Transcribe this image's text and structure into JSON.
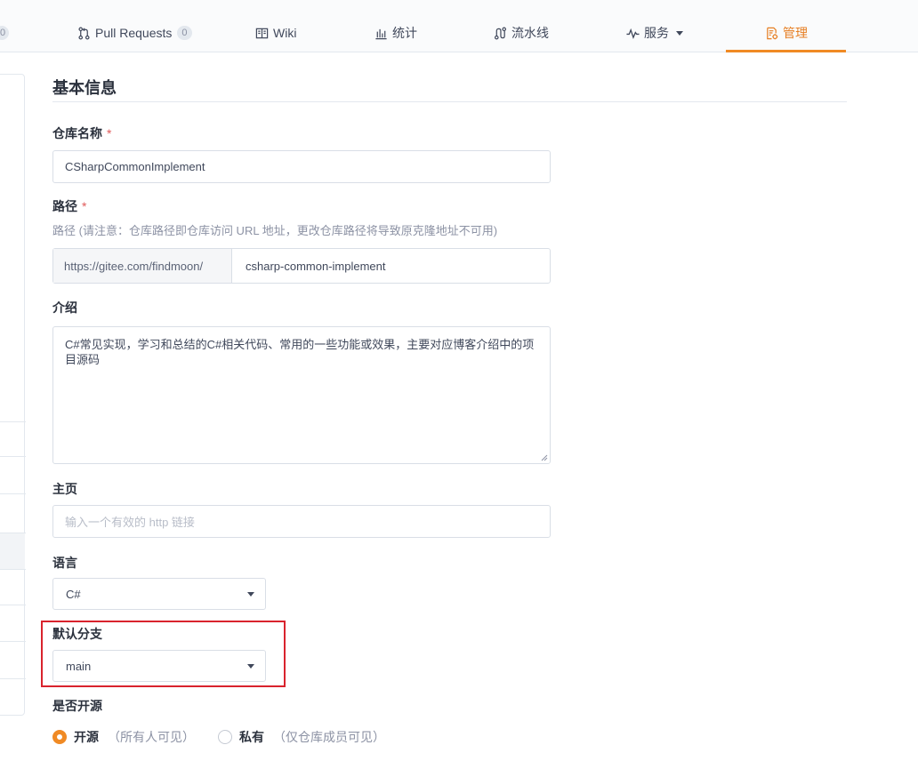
{
  "nav": {
    "left_badge": "0",
    "items": [
      {
        "label": "Pull Requests",
        "badge": "0"
      },
      {
        "label": "Wiki"
      },
      {
        "label": "统计"
      },
      {
        "label": "流水线"
      },
      {
        "label": "服务"
      },
      {
        "label": "管理"
      }
    ],
    "active_color": "#f08a24"
  },
  "form": {
    "section_title": "基本信息",
    "repo_name": {
      "label": "仓库名称",
      "required": "*",
      "value": "CSharpCommonImplement"
    },
    "path": {
      "label": "路径",
      "required": "*",
      "hint": "路径 (请注意：仓库路径即仓库访问 URL 地址，更改仓库路径将导致原克隆地址不可用)",
      "prefix": "https://gitee.com/findmoon/",
      "value": "csharp-common-implement"
    },
    "intro": {
      "label": "介绍",
      "value": "C#常见实现，学习和总结的C#相关代码、常用的一些功能或效果，主要对应博客介绍中的项目源码"
    },
    "homepage": {
      "label": "主页",
      "placeholder": "输入一个有效的 http 链接"
    },
    "language": {
      "label": "语言",
      "value": "C#"
    },
    "default_branch": {
      "label": "默认分支",
      "value": "main"
    },
    "open_source": {
      "label": "是否开源",
      "options": [
        {
          "label": "开源",
          "desc": "（所有人可见）",
          "selected": true
        },
        {
          "label": "私有",
          "desc": "（仅仓库成员可见）",
          "selected": false
        }
      ]
    }
  },
  "colors": {
    "highlight": "#d9232d",
    "accent": "#f08a24"
  }
}
